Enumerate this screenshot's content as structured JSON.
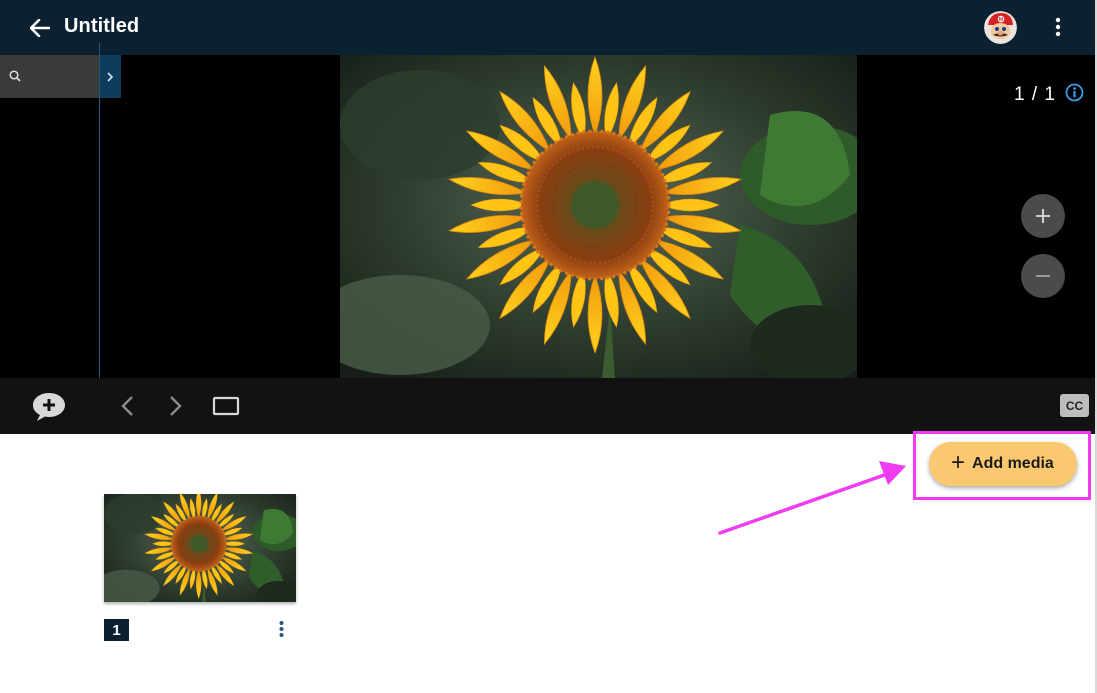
{
  "header": {
    "title": "Untitled",
    "back_icon": "arrow-left-icon",
    "avatar_icon": "user-avatar",
    "menu_icon": "more-vertical-icon",
    "background": "#0b2030"
  },
  "viewer": {
    "search_icon": "search-icon",
    "sidebar_toggle_icon": "chevron-right-icon",
    "page_indicator": "1 / 1",
    "info_icon": "info-icon",
    "zoom_in_icon": "plus-icon",
    "zoom_out_icon": "minus-icon",
    "image_subject": "sunflower"
  },
  "controls": {
    "comment_icon": "add-comment-icon",
    "prev_icon": "chevron-left-icon",
    "next_icon": "chevron-right-icon",
    "frame_icon": "fit-frame-icon",
    "cc_label": "CC"
  },
  "media": {
    "add_label": "Add media",
    "add_color": "#fcc86f",
    "highlight_color": "#f03cf0",
    "slides": [
      {
        "number": "1",
        "menu_icon": "more-vertical-icon"
      }
    ]
  }
}
